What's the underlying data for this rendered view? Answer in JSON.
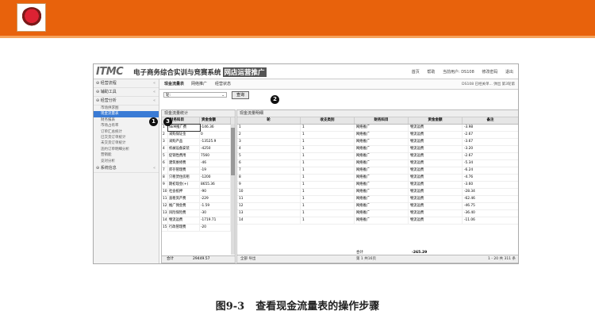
{
  "shot": {
    "brand": "ITMC",
    "system_title": "电子商务综合实训与竞赛系统",
    "system_tag": "网店运营推广",
    "top_links": [
      "首页",
      "帮助",
      "当前用户: DS108",
      "修改密码",
      "退出"
    ],
    "sidebar": {
      "sections": [
        "经营流程",
        "辅助工具",
        "经营分析"
      ],
      "sub_items": [
        "市场供求图",
        "现金流量表",
        "财务报表",
        "市场占有率",
        "订单汇总统计",
        "已交货订单统计",
        "未交货订单统计",
        "违约订单明细分析",
        "营销能",
        "竞对分析"
      ],
      "last_section": "系统信息",
      "active": "现金流量表"
    },
    "tabs": [
      "现金流量表",
      "网络推广",
      "经营状态"
    ],
    "toolbar_right": "DS108 已经关单...   弹出   第3轮第",
    "filter": {
      "select_value": "轮:",
      "query_label": "查询"
    },
    "callouts": [
      "1",
      "2",
      "3"
    ],
    "left_panel": {
      "title": "现金流量统计",
      "headers": [
        "",
        "财务科目",
        "资金金额"
      ],
      "rows": [
        [
          "1",
          "SEM推广费",
          "-146.36"
        ],
        [
          "2",
          "采购保证金",
          "0"
        ],
        [
          "3",
          "采购产品",
          "-13525.9"
        ],
        [
          "4",
          "机械设备安装",
          "-4250"
        ],
        [
          "5",
          "促销性费用",
          "7560"
        ],
        [
          "6",
          "建筑维修费",
          "-46"
        ],
        [
          "7",
          "库存管理费",
          "-19"
        ],
        [
          "8",
          "只租赁住房租",
          "-1200"
        ],
        [
          "9",
          "期初现金(+)",
          "8655.36"
        ],
        [
          "10",
          "社会抵押",
          "-90"
        ],
        [
          "11",
          "直租资产费",
          "-229"
        ],
        [
          "12",
          "推广佣金费",
          "-1.59"
        ],
        [
          "13",
          "风险保险费",
          "-30"
        ],
        [
          "14",
          "物流运费",
          "-1719.71"
        ],
        [
          "15",
          "行政管理费",
          "-20"
        ]
      ],
      "total_label": "合计",
      "total_value": "29449.57"
    },
    "right_panel": {
      "title": "现金流量明细",
      "headers": [
        "轮",
        "收支类别",
        "财务科目",
        "资金金额",
        "备注"
      ],
      "rows": [
        [
          "1",
          "1",
          "网络推广",
          "物流运费",
          "-3.98"
        ],
        [
          "2",
          "1",
          "网络推广",
          "物流运费",
          "-2.67"
        ],
        [
          "3",
          "1",
          "网络推广",
          "物流运费",
          "-3.67"
        ],
        [
          "4",
          "1",
          "网络推广",
          "物流运费",
          "-3.20"
        ],
        [
          "5",
          "1",
          "网络推广",
          "物流运费",
          "-2.67"
        ],
        [
          "6",
          "1",
          "网络推广",
          "物流运费",
          "-5.34"
        ],
        [
          "7",
          "1",
          "网络推广",
          "物流运费",
          "-6.24"
        ],
        [
          "8",
          "1",
          "网络推广",
          "物流运费",
          "-4.76"
        ],
        [
          "9",
          "1",
          "网络推广",
          "物流运费",
          "-3.60"
        ],
        [
          "10",
          "1",
          "网络推广",
          "物流运费",
          "-28.34"
        ],
        [
          "11",
          "1",
          "网络推广",
          "物流运费",
          "-62.46"
        ],
        [
          "12",
          "1",
          "网络推广",
          "物流运费",
          "-46.75"
        ],
        [
          "13",
          "1",
          "网络推广",
          "物流运费",
          "-36.40"
        ],
        [
          "14",
          "1",
          "网络推广",
          "物流运费",
          "-11.06"
        ]
      ],
      "total_label": "合计",
      "total_value": "-265.29",
      "footer_left": "全部   导出",
      "pager": "第 1 共16页",
      "range": "1 - 20  共 311 条"
    }
  },
  "caption": {
    "figure_no": "图9-3",
    "text": "查看现金流量表的操作步骤"
  }
}
